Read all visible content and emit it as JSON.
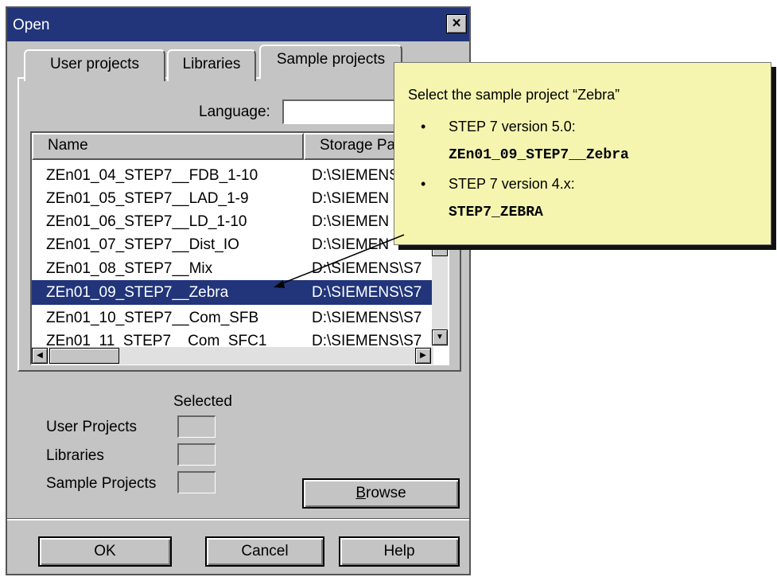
{
  "dialog": {
    "title": "Open",
    "close_glyph": "×",
    "tabs": [
      {
        "label": "User projects"
      },
      {
        "label": "Libraries"
      },
      {
        "label": "Sample projects",
        "active": true
      }
    ],
    "language_label": "Language:",
    "language_value": "",
    "columns": [
      "Name",
      "Storage Pa"
    ],
    "rows": [
      {
        "name": "ZEn01_04_STEP7__FDB_1-10",
        "path": "D:\\SIEMENS"
      },
      {
        "name": "ZEn01_05_STEP7__LAD_1-9",
        "path": "D:\\SIEMEN"
      },
      {
        "name": "ZEn01_06_STEP7__LD_1-10",
        "path": "D:\\SIEMEN"
      },
      {
        "name": "ZEn01_07_STEP7__Dist_IO",
        "path": "D:\\SIEMEN"
      },
      {
        "name": "ZEn01_08_STEP7__Mix",
        "path": "D:\\SIEMENS\\S7"
      },
      {
        "name": "ZEn01_09_STEP7__Zebra",
        "path": "D:\\SIEMENS\\S7",
        "selected": true
      },
      {
        "name": "ZEn01_10_STEP7__Com_SFB",
        "path": "D:\\SIEMENS\\S7"
      },
      {
        "name": "ZEn01_11_STEP7__Com_SFC1",
        "path": "D:\\SIEMENS\\S7"
      }
    ],
    "selected_header": "Selected",
    "selected_counts": [
      {
        "label": "User Projects",
        "value": ""
      },
      {
        "label": "Libraries",
        "value": ""
      },
      {
        "label": "Sample Projects",
        "value": ""
      }
    ],
    "browse_label_prefix": "",
    "browse_underline": "B",
    "browse_label_rest": "rowse",
    "buttons": {
      "ok": "OK",
      "cancel": "Cancel",
      "help": "Help"
    },
    "colors": {
      "titlebar": "#22357a",
      "selection": "#22357a",
      "face": "#c4c4c4"
    }
  },
  "callout": {
    "heading": "Select the sample project “Zebra”",
    "bullet": "•",
    "items": [
      {
        "label": "STEP 7 version 5.0:",
        "project": "ZEn01_09_STEP7__Zebra"
      },
      {
        "label": "STEP 7 version 4.x:",
        "project": "STEP7_ZEBRA"
      }
    ],
    "background": "#f5f5b0"
  }
}
